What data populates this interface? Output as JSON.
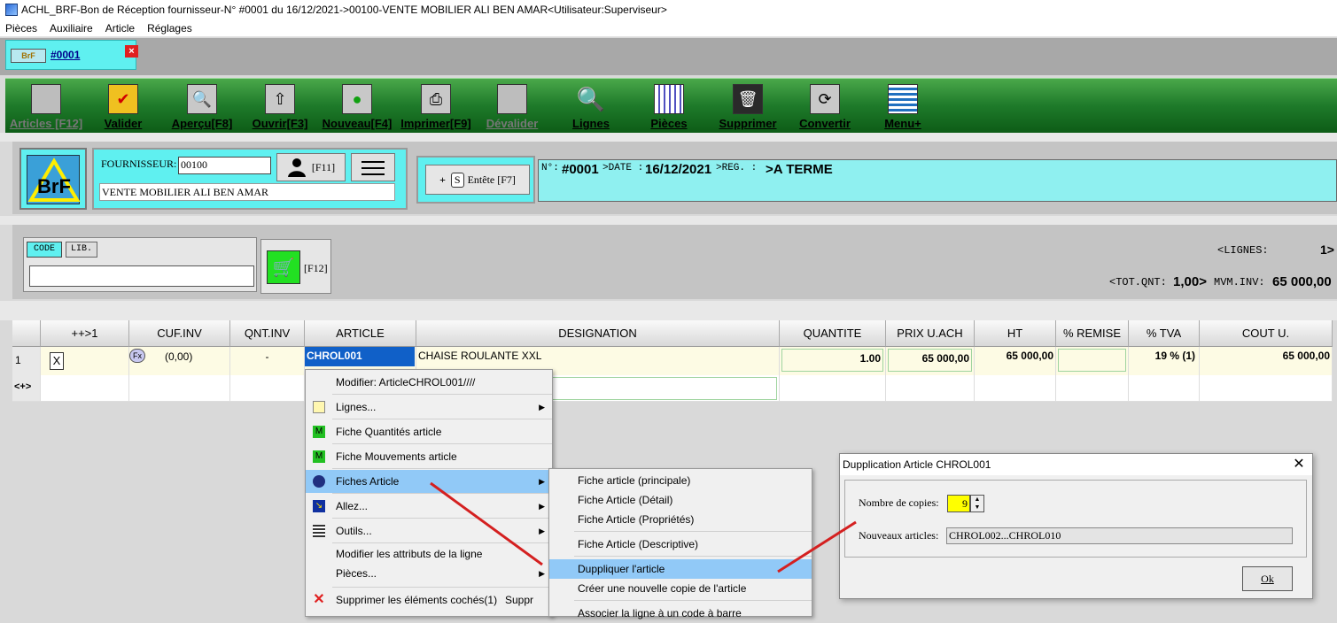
{
  "window": {
    "title": "ACHL_BRF-Bon de Réception fournisseur-N° #0001 du 16/12/2021->00100-VENTE MOBILIER ALI BEN AMAR<Utilisateur:Superviseur>"
  },
  "menubar": [
    "Pièces",
    "Auxiliaire",
    "Article",
    "Réglages"
  ],
  "doc_tab": {
    "badge": "BrF",
    "number": "#0001",
    "close": "×"
  },
  "toolbar": [
    {
      "label": "Articles [F12]",
      "icon": "article-icon",
      "enabled": false
    },
    {
      "label": "Valider",
      "icon": "check-icon",
      "enabled": true
    },
    {
      "label": "Aperçu[F8]",
      "icon": "preview-icon",
      "enabled": true
    },
    {
      "label": "Ouvrir[F3]",
      "icon": "open-icon",
      "enabled": true
    },
    {
      "label": "Nouveau[F4]",
      "icon": "new-icon",
      "enabled": true
    },
    {
      "label": "Imprimer[F9]",
      "icon": "printer-icon",
      "enabled": true
    },
    {
      "label": "Dévalider",
      "icon": "unvalidate-icon",
      "enabled": false
    },
    {
      "label": "Lignes",
      "icon": "magnifier-icon",
      "enabled": true
    },
    {
      "label": "Pièces",
      "icon": "grid-icon",
      "enabled": true
    },
    {
      "label": "Supprimer",
      "icon": "trash-icon",
      "enabled": true
    },
    {
      "label": "Convertir",
      "icon": "convert-icon",
      "enabled": true
    },
    {
      "label": "Menu+",
      "icon": "menu-icon",
      "enabled": true
    }
  ],
  "supplier": {
    "label": "FOURNISSEUR:",
    "code": "00100",
    "name": "VENTE MOBILIER ALI BEN AMAR",
    "button_key": "[F11]"
  },
  "header_button": {
    "plus": "+",
    "s": "S",
    "label": "Entête [F7]"
  },
  "doc_info": {
    "no_label": "N°:",
    "no_value": "#0001",
    "date_label": ">DATE :",
    "date_value": "16/12/2021",
    "reg_label": ">REG.  :",
    "reg_value": ">A TERME"
  },
  "search": {
    "code_btn": "CODE",
    "lib_btn": "LIB.",
    "cart_key": "[F12]"
  },
  "totals": {
    "lignes_label": "<LIGNES:",
    "lignes_value": "1>",
    "totq_label": "<TOT.QNT:",
    "totq_value": "1,00>",
    "mvm_label": "MVM.INV:",
    "mvm_value": "65 000,00"
  },
  "grid": {
    "headers": [
      "",
      "++>1",
      "CUF.INV",
      "QNT.INV",
      "ARTICLE",
      "DESIGNATION",
      "QUANTITE",
      "PRIX U.ACH",
      "HT",
      "% REMISE",
      "% TVA",
      "COUT U."
    ],
    "row1": {
      "num": "1",
      "check": "X",
      "fx": "Fx",
      "cuf": "(0,00)",
      "qnt": "-",
      "article": "CHROL001",
      "designation": "CHAISE ROULANTE XXL",
      "quantite": "1.00",
      "prix": "65 000,00",
      "ht": "65 000,00",
      "remise": "",
      "tva": "19 % (1)",
      "cout": "65 000,00"
    },
    "row2": {
      "num": "<+>"
    }
  },
  "context_menu": [
    {
      "label": "Modifier: ArticleCHROL001////",
      "icon": "",
      "arrow": false
    },
    {
      "label": "Lignes...",
      "icon": "document-icon",
      "arrow": true
    },
    {
      "label": "Fiche Quantités article",
      "icon": "green-m-icon",
      "arrow": false
    },
    {
      "label": "Fiche Mouvements article",
      "icon": "green-m-icon",
      "arrow": false
    },
    {
      "label": "Fiches Article",
      "icon": "disc-icon",
      "arrow": true,
      "highlighted": true
    },
    {
      "label": "Allez...",
      "icon": "goto-icon",
      "arrow": true
    },
    {
      "label": "Outils...",
      "icon": "tools-icon",
      "arrow": true
    },
    {
      "label": "Modifier les attributs de la ligne",
      "icon": "",
      "arrow": false
    },
    {
      "label": "Pièces...",
      "icon": "",
      "arrow": true
    },
    {
      "label": "Supprimer les éléments cochés(1)",
      "shortcut": "Suppr",
      "icon": "red-x-icon",
      "arrow": false
    }
  ],
  "submenu": [
    {
      "label": "Fiche article (principale)"
    },
    {
      "label": "Fiche Article (Détail)"
    },
    {
      "label": "Fiche Article (Propriétés)"
    },
    {
      "label": "Fiche Article (Descriptive)"
    },
    {
      "label": "Duppliquer l'article",
      "highlighted": true
    },
    {
      "label": "Créer une nouvelle copie de l'article"
    },
    {
      "label": "Associer la ligne à un code à barre"
    }
  ],
  "dialog": {
    "title": "Dupplication Article CHROL001",
    "close": "✕",
    "copies_label": "Nombre de copies:",
    "copies_value": "9",
    "new_label": "Nouveaux articles:",
    "new_value": "CHROL002...CHROL010",
    "ok": "Ok"
  },
  "colors": {
    "cyan": "#5ff0f0",
    "toolbar_green": "#1e7a2a",
    "highlight": "#91c9f7",
    "arrow_red": "#d42020"
  }
}
